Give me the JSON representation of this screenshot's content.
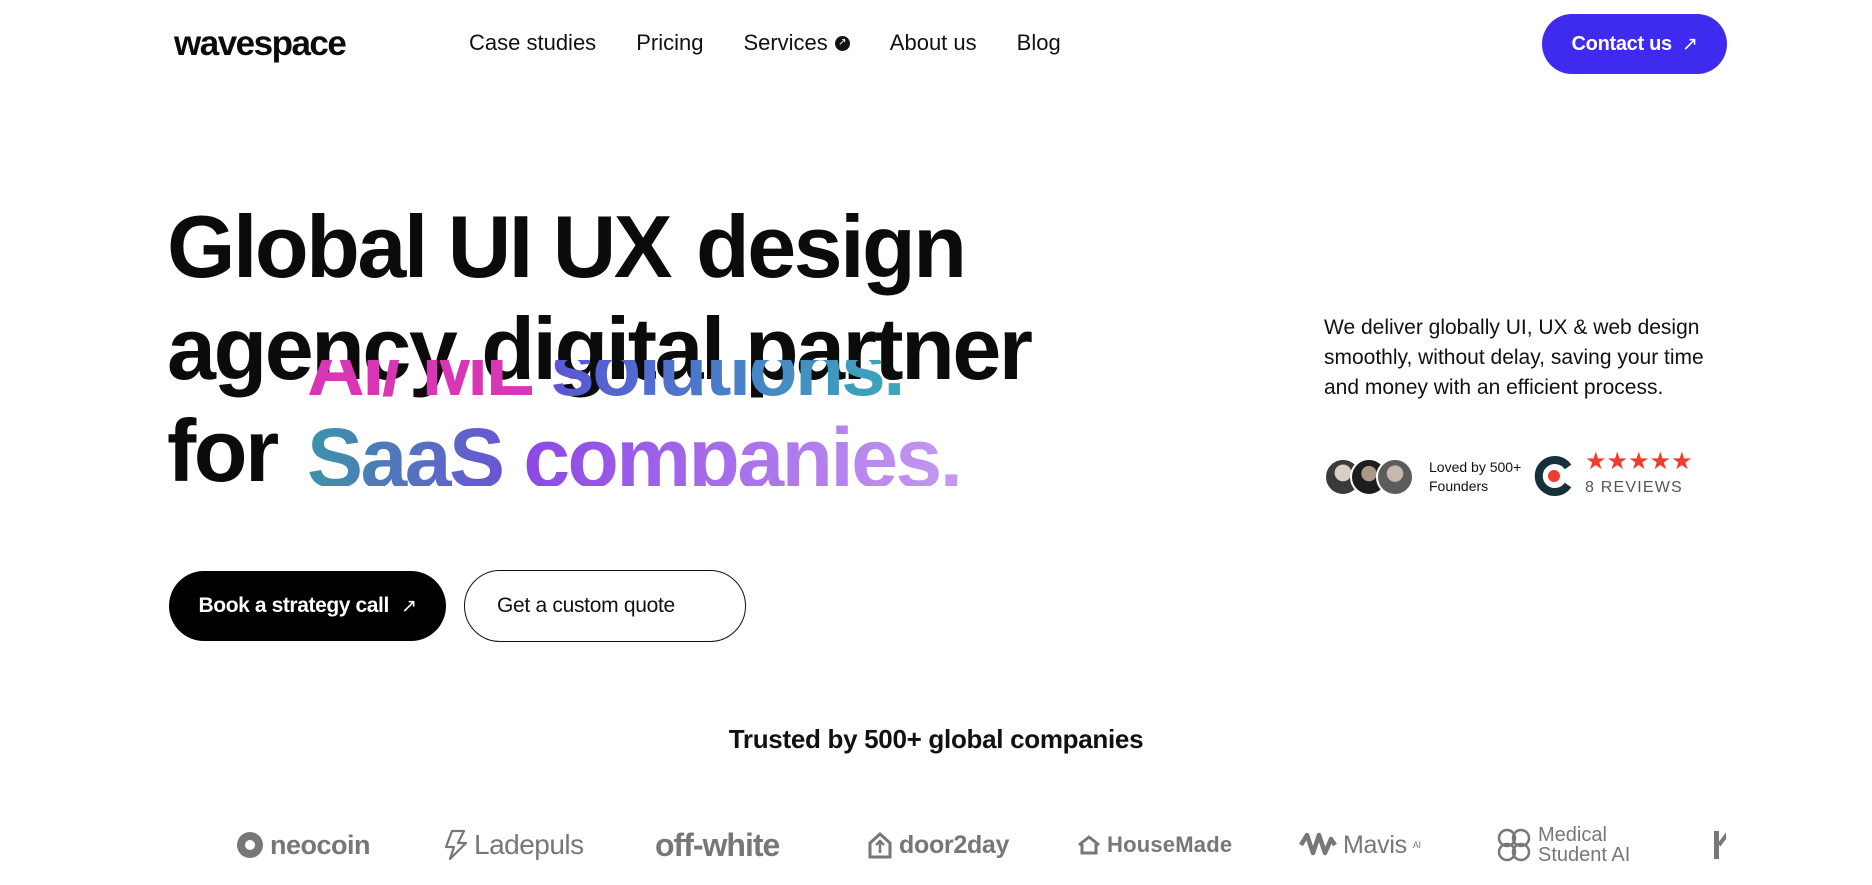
{
  "brand": {
    "name": "wavespace"
  },
  "nav": {
    "items": [
      {
        "label": "Case studies"
      },
      {
        "label": "Pricing"
      },
      {
        "label": "Services"
      },
      {
        "label": "About us"
      },
      {
        "label": "Blog"
      }
    ],
    "contact_label": "Contact us"
  },
  "hero": {
    "line1_a": "Global UI UX",
    "line1_b": "design",
    "line2_a": "agency",
    "line2_b": "digital partner",
    "line3_lead": "for",
    "rotating_prev_a": "AI/ ML",
    "rotating_prev_b": "solutions.",
    "rotating_cur_a": "SaaS",
    "rotating_cur_b": "companies."
  },
  "description": "We deliver globally UI, UX & web design smoothly, without delay, saving your time and money with an efficient process.",
  "social_proof": {
    "loved_line1": "Loved by 500+",
    "loved_line2": "Founders",
    "stars": "★★★★★",
    "reviews": "8 REVIEWS"
  },
  "cta": {
    "primary": "Book a strategy call",
    "secondary": "Get a custom quote"
  },
  "trusted_heading": "Trusted by 500+ global companies",
  "client_logos": {
    "neocoin": "neocoin",
    "ladepuls": "Ladepuls",
    "offwhite": "off-white",
    "door2day": "door2day",
    "housemade": "HouseMade",
    "mavis": "Mavis",
    "mavis_sup": "AI",
    "medical_1": "Medical",
    "medical_2": "Student AI"
  },
  "colors": {
    "accent": "#3f2bf0",
    "star": "#ef3c2d",
    "clutch_red": "#ef3c2d",
    "clutch_dark": "#17313b"
  }
}
